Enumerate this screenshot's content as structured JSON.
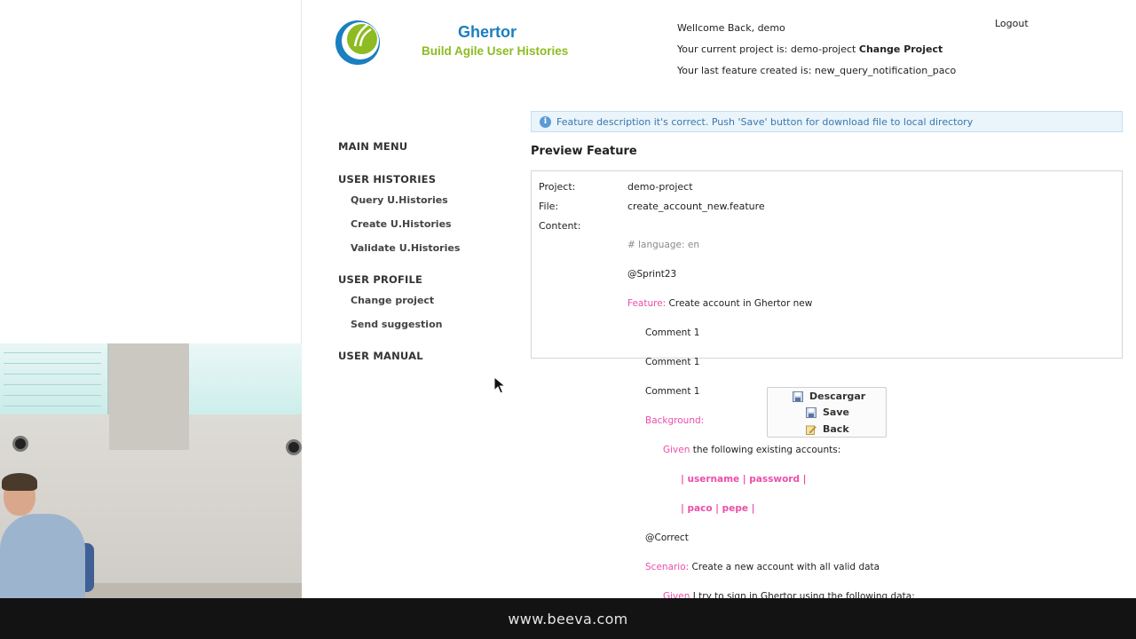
{
  "app": {
    "logo_name": "Ghertor",
    "logo_tagline": "Build Agile User Histories"
  },
  "header": {
    "welcome": "Wellcome Back, demo",
    "current_project_prefix": "Your current project is: demo-project",
    "change_project": "Change Project",
    "last_feature": "Your last feature created is: new_query_notification_paco",
    "logout": "Logout"
  },
  "sidebar": {
    "main_menu": "MAIN MENU",
    "user_histories": "USER HISTORIES",
    "query": "Query U.Histories",
    "create": "Create U.Histories",
    "validate": "Validate U.Histories",
    "user_profile": "USER PROFILE",
    "change_project": "Change project",
    "send_suggestion": "Send suggestion",
    "user_manual": "USER MANUAL"
  },
  "notice": {
    "icon": "info-icon",
    "message": "Feature description it's correct. Push 'Save' button for download file to local directory"
  },
  "preview": {
    "title": "Preview Feature",
    "project_label": "Project:",
    "project_value": "demo-project",
    "file_label": "File:",
    "file_value": "create_account_new.feature",
    "content_label": "Content:",
    "content": {
      "language": "# language: en",
      "tag1": "@Sprint23",
      "feature_kw": "Feature:",
      "feature_text": " Create account in Ghertor new",
      "comment1": "Comment 1",
      "comment2": "Comment 1",
      "comment3": "Comment 1",
      "background_kw": "Background:",
      "given1_kw": "Given",
      "given1_text": " the following existing accounts:",
      "table_header": "| username | password |",
      "table_row": "| paco | pepe |",
      "tag2": "@Correct",
      "scenario_kw": "Scenario:",
      "scenario_text": " Create a new account with all valid data",
      "given2_kw": "Given",
      "given2_text": " I try to sign in Ghertor using the following data:"
    }
  },
  "actions": {
    "descargar": "Descargar",
    "save": "Save",
    "back": "Back"
  },
  "footer": {
    "url": "www.beeva.com"
  },
  "colors": {
    "keyword_pink": "#ec4ea8",
    "logo_blue": "#1a7fc0",
    "logo_green": "#8dbb21",
    "notice_bg": "#eaf4fb",
    "notice_text": "#3a78ad"
  }
}
